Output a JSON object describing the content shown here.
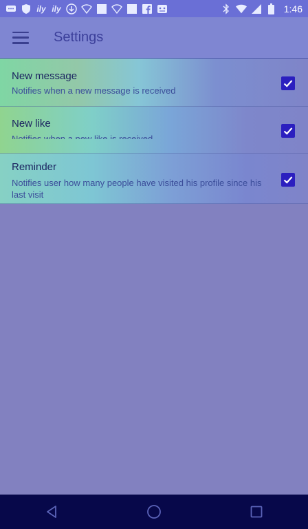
{
  "status_bar": {
    "time": "1:46",
    "left_icons": [
      "message-icon",
      "shield-icon",
      "ily-icon",
      "ily-icon",
      "download-icon",
      "wifi-icon",
      "square-icon",
      "wifi-icon",
      "square-icon",
      "facebook-icon",
      "gamepad-icon"
    ],
    "right_icons": [
      "bluetooth-icon",
      "wifi-signal-icon",
      "cell-signal-icon",
      "battery-icon"
    ],
    "ily_label": "ily"
  },
  "app_bar": {
    "title": "Settings",
    "menu_icon": "hamburger-menu-icon"
  },
  "settings": [
    {
      "title": "New message",
      "subtitle": "Notifies when a new message is received",
      "checked": true
    },
    {
      "title": "New like",
      "subtitle": "Notifies when a new like is received",
      "checked": true
    },
    {
      "title": "Reminder",
      "subtitle": "Notifies user how many people have visited his profile since his last visit",
      "checked": true
    }
  ],
  "nav_bar": {
    "buttons": [
      "back-icon",
      "home-icon",
      "recents-icon"
    ]
  },
  "colors": {
    "accent": "#2b1fbf",
    "title": "#3b3f9a",
    "nav_bar": "#07084a"
  }
}
